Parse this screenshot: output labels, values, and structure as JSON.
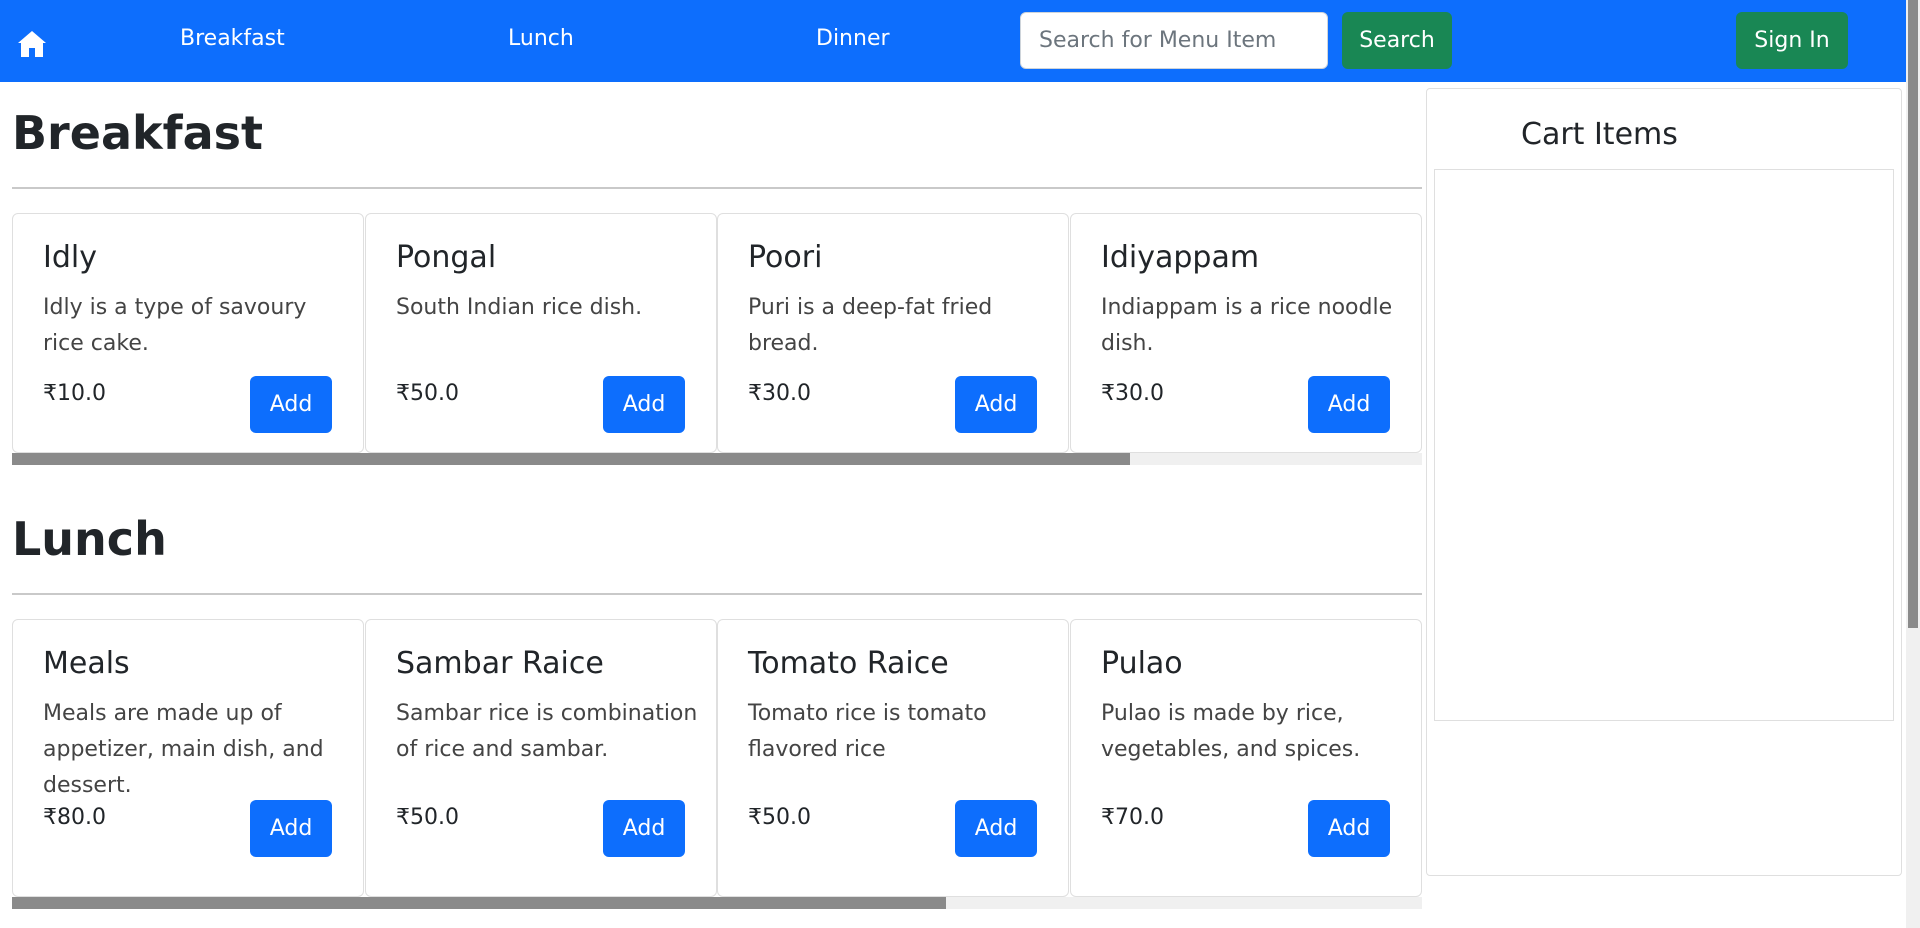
{
  "navbar": {
    "home_icon": "home-icon",
    "links": [
      "Breakfast",
      "Lunch",
      "Dinner"
    ],
    "search_placeholder": "Search for Menu Item",
    "search_label": "Search",
    "signin_label": "Sign In",
    "accent_color": "#0d6efd",
    "success_color": "#198754"
  },
  "sections": [
    {
      "title": "Breakfast",
      "items": [
        {
          "name": "Idly",
          "desc": "Idly is a type of savoury rice cake.",
          "price": "₹10.0",
          "button": "Add"
        },
        {
          "name": "Pongal",
          "desc": "South Indian rice dish.",
          "price": "₹50.0",
          "button": "Add"
        },
        {
          "name": "Poori",
          "desc": "Puri is a deep-fat fried bread.",
          "price": "₹30.0",
          "button": "Add"
        },
        {
          "name": "Idiyappam",
          "desc": "Indiappam is a rice noodle dish.",
          "price": "₹30.0",
          "button": "Add"
        }
      ]
    },
    {
      "title": "Lunch",
      "items": [
        {
          "name": "Meals",
          "desc": "Meals are made up of appetizer, main dish, and dessert.",
          "price": "₹80.0",
          "button": "Add"
        },
        {
          "name": "Sambar Raice",
          "desc": "Sambar rice is combination of rice and sambar.",
          "price": "₹50.0",
          "button": "Add"
        },
        {
          "name": "Tomato Raice",
          "desc": "Tomato rice is tomato flavored rice",
          "price": "₹50.0",
          "button": "Add"
        },
        {
          "name": "Pulao",
          "desc": "Pulao is made by rice, vegetables, and spices.",
          "price": "₹70.0",
          "button": "Add"
        }
      ]
    }
  ],
  "cart": {
    "title": "Cart Items"
  }
}
